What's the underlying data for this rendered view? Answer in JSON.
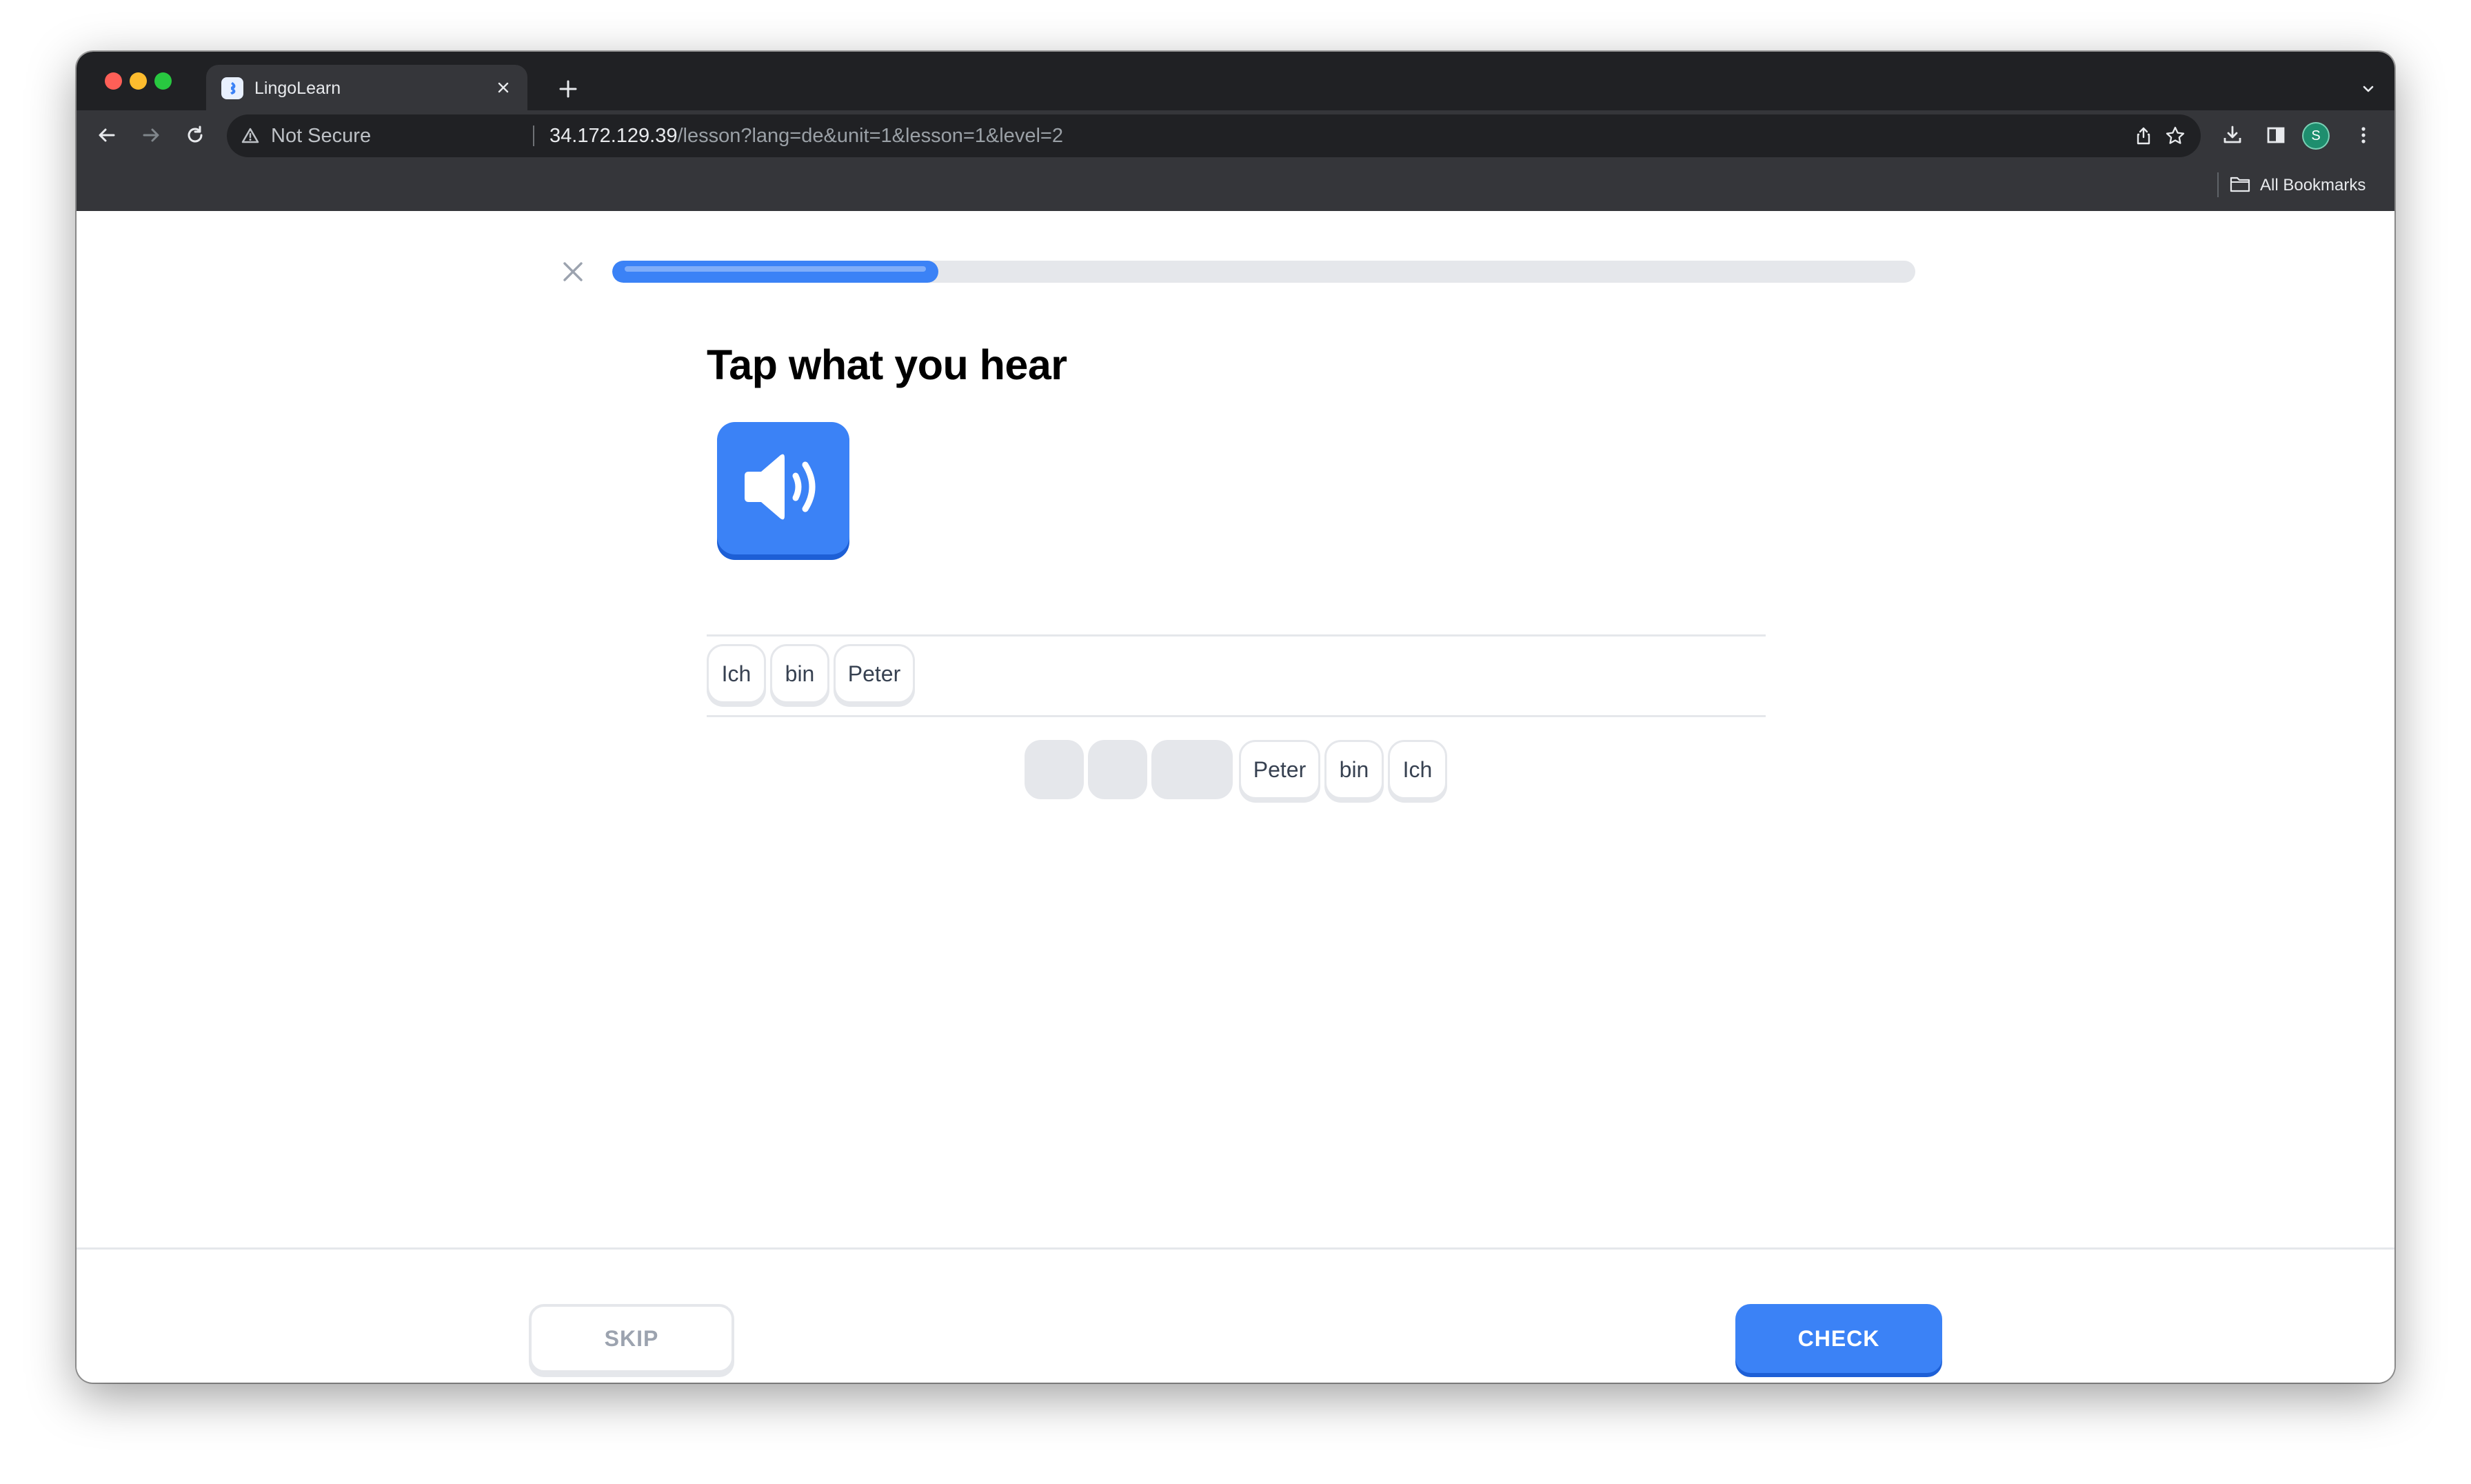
{
  "browser": {
    "tab": {
      "title": "LingoLearn",
      "favicon": "lingolearn-logo-icon"
    },
    "omnibox": {
      "security_label": "Not Secure",
      "url_host": "34.172.129.39",
      "url_path": "/lesson?lang=de&unit=1&lesson=1&level=2"
    },
    "profile_initial": "S",
    "bookmarks_label": "All Bookmarks"
  },
  "lesson": {
    "progress_fraction": 0.25,
    "prompt": "Tap what you hear",
    "audio_icon": "speaker-icon",
    "answer_words": [
      "Ich",
      "bin",
      "Peter"
    ],
    "word_bank": {
      "used_slots": 3,
      "remaining": [
        "Peter",
        "bin",
        "Ich"
      ]
    }
  },
  "footer": {
    "skip_label": "SKIP",
    "check_label": "CHECK"
  },
  "colors": {
    "accent": "#3b82f6",
    "accent_dark": "#1d5fd6",
    "border": "#e5e7eb",
    "muted_text": "#9ca3af"
  }
}
